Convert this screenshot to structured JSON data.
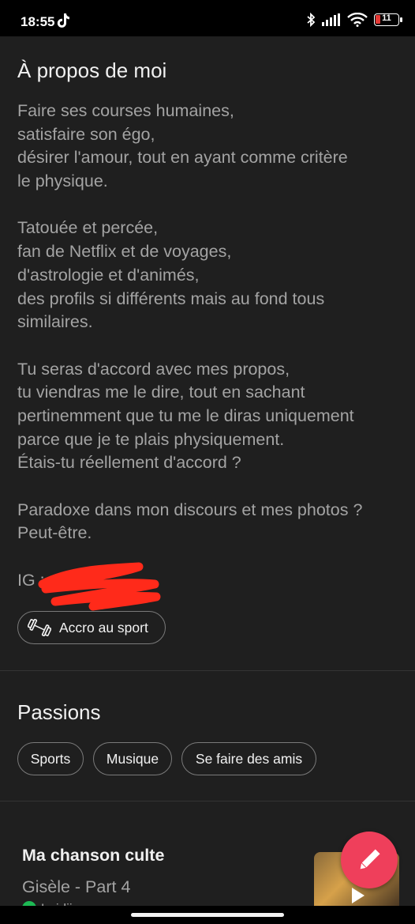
{
  "status_bar": {
    "time": "18:55",
    "battery": "11"
  },
  "about": {
    "title": "À propos de moi",
    "bio_lines": [
      "Faire ses courses humaines,",
      "satisfaire son égo,",
      "désirer l'amour, tout en ayant comme critère",
      "le physique.",
      "",
      "Tatouée et percée,",
      "fan de Netflix et de voyages,",
      "d'astrologie et d'animés,",
      "des profils si différents mais au fond tous",
      "similaires.",
      "",
      "Tu seras d'accord avec mes propos,",
      "tu viendras me le dire, tout en sachant",
      "pertinemment que tu me le diras uniquement",
      "parce que je te plais physiquement.",
      "Étais-tu réellement d'accord ?",
      "",
      "Paradoxe dans mon discours et mes photos ?",
      "Peut-être."
    ],
    "ig_prefix": "IG :",
    "lifestyle_chip": "Accro au sport"
  },
  "passions": {
    "title": "Passions",
    "items": [
      "Sports",
      "Musique",
      "Se faire des amis"
    ]
  },
  "anthem": {
    "title": "Ma chanson culte",
    "song": "Gisèle - Part 4",
    "artist": "Luidji"
  },
  "colors": {
    "background": "#1f1f1f",
    "fab": "#ef3f5b",
    "spotify": "#1db954",
    "redaction": "#ff2a1a"
  }
}
